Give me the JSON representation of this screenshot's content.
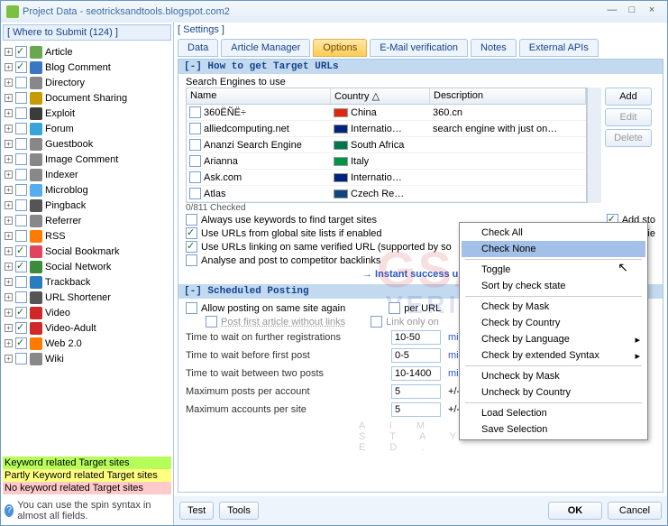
{
  "title": "Project Data - seotricksandtools.blogspot.com2",
  "left": {
    "header": "[ Where to Submit  (124) ]",
    "items": [
      {
        "label": "Article",
        "chk": true,
        "color": "#6aa84f"
      },
      {
        "label": "Blog Comment",
        "chk": true,
        "color": "#3b76c4"
      },
      {
        "label": "Directory",
        "chk": false,
        "color": "#888"
      },
      {
        "label": "Document Sharing",
        "chk": false,
        "color": "#c79a00"
      },
      {
        "label": "Exploit",
        "chk": false,
        "color": "#3b3b3b"
      },
      {
        "label": "Forum",
        "chk": false,
        "color": "#3aa3d8"
      },
      {
        "label": "Guestbook",
        "chk": false,
        "color": "#888"
      },
      {
        "label": "Image Comment",
        "chk": false,
        "color": "#888"
      },
      {
        "label": "Indexer",
        "chk": false,
        "color": "#888"
      },
      {
        "label": "Microblog",
        "chk": false,
        "color": "#55acee"
      },
      {
        "label": "Pingback",
        "chk": false,
        "color": "#555"
      },
      {
        "label": "Referrer",
        "chk": false,
        "color": "#888"
      },
      {
        "label": "RSS",
        "chk": false,
        "color": "#ff7a00"
      },
      {
        "label": "Social Bookmark",
        "chk": true,
        "color": "#e0445e"
      },
      {
        "label": "Social Network",
        "chk": true,
        "color": "#3b8b3b"
      },
      {
        "label": "Trackback",
        "chk": false,
        "color": "#2a7bbf"
      },
      {
        "label": "URL Shortener",
        "chk": false,
        "color": "#555"
      },
      {
        "label": "Video",
        "chk": true,
        "color": "#d02828"
      },
      {
        "label": "Video-Adult",
        "chk": true,
        "color": "#d02828"
      },
      {
        "label": "Web 2.0",
        "chk": true,
        "color": "#ff7a00"
      },
      {
        "label": "Wiki",
        "chk": false,
        "color": "#888"
      }
    ],
    "legend": [
      "Keyword related Target sites",
      "Partly Keyword related Target sites",
      "No keyword related Target sites"
    ],
    "hint": "You can use the spin syntax in almost all fields."
  },
  "settings_label": "[ Settings ]",
  "tabs": [
    "Data",
    "Article Manager",
    "Options",
    "E-Mail verification",
    "Notes",
    "External APIs"
  ],
  "active_tab": 2,
  "sec1": {
    "title": "[-] How to get Target URLs",
    "sub": "Search Engines to use",
    "cols": [
      "Name",
      "Country  △",
      "Description"
    ],
    "rows": [
      {
        "name": "360ËÑË÷",
        "flag": "#de2910",
        "country": "China",
        "desc": "360.cn"
      },
      {
        "name": "alliedcomputing.net",
        "flag": "#00247d",
        "country": "Internatio…",
        "desc": "search engine with just on…"
      },
      {
        "name": "Ananzi Search Engine",
        "flag": "#007749",
        "country": "South Africa",
        "desc": ""
      },
      {
        "name": "Arianna",
        "flag": "#009246",
        "country": "Italy",
        "desc": ""
      },
      {
        "name": "Ask.com",
        "flag": "#00247d",
        "country": "Internatio…",
        "desc": ""
      },
      {
        "name": "Atlas",
        "flag": "#11457e",
        "country": "Czech Re…",
        "desc": ""
      }
    ],
    "btns": {
      "add": "Add",
      "edit": "Edit",
      "del": "Delete"
    },
    "status": "0/811 Checked",
    "opts": {
      "kw": "Always use keywords to find target sites",
      "kw_chk": false,
      "addsto": "Add sto",
      "global": "Use URLs from global site lists if enabled",
      "global_chk": true,
      "ident": "Identifie",
      "same": "Use URLs linking on same verified URL (supported by so",
      "same_chk": true,
      "comp": "Analyse and post to competitor backlinks",
      "comp_chk": false
    },
    "instant": "→ Instant success using"
  },
  "sec2": {
    "title": "[-] Scheduled Posting",
    "allow": "Allow posting on same site again",
    "allow_chk": false,
    "perurl": "per URL",
    "perurl_chk": false,
    "postfirst": "Post first article without links",
    "postfirst_chk": false,
    "linkonly": "Link only on",
    "linkonly_chk": false,
    "fields": [
      {
        "label": "Time to wait on further registrations",
        "val": "10-50",
        "unit": "minu"
      },
      {
        "label": "Time to wait before first post",
        "val": "0-5",
        "unit": "minu"
      },
      {
        "label": "Time to wait between two posts",
        "val": "10-1400",
        "unit": "minutes"
      },
      {
        "label": "Maximum posts per account",
        "val": "5",
        "spin": "0",
        "pm": "+/-"
      },
      {
        "label": "Maximum accounts per site",
        "val": "5",
        "spin": "0",
        "pm": "+/-"
      }
    ]
  },
  "ctx": [
    "Check All",
    "Check None",
    "Toggle",
    "Sort by check state",
    "Check by Mask",
    "Check by Country",
    "Check by Language",
    "Check by extended Syntax",
    "Uncheck by Mask",
    "Uncheck by Country",
    "Load Selection",
    "Save Selection"
  ],
  "footer": {
    "test": "Test",
    "tools": "Tools",
    "ok": "OK",
    "cancel": "Cancel"
  }
}
